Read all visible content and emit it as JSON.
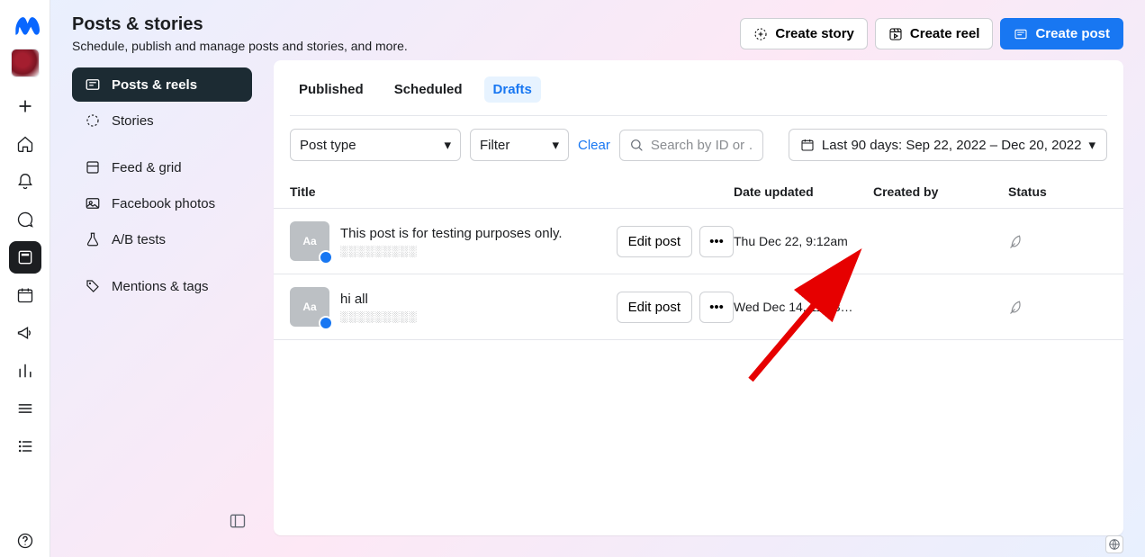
{
  "header": {
    "title": "Posts & stories",
    "subtitle": "Schedule, publish and manage posts and stories, and more.",
    "actions": {
      "create_story": "Create story",
      "create_reel": "Create reel",
      "create_post": "Create post"
    }
  },
  "sidebar": {
    "items": [
      {
        "label": "Posts & reels"
      },
      {
        "label": "Stories"
      },
      {
        "label": "Feed & grid"
      },
      {
        "label": "Facebook photos"
      },
      {
        "label": "A/B tests"
      },
      {
        "label": "Mentions & tags"
      }
    ]
  },
  "tabs": {
    "published": "Published",
    "scheduled": "Scheduled",
    "drafts": "Drafts"
  },
  "filters": {
    "post_type": "Post type",
    "filter": "Filter",
    "clear": "Clear",
    "search_placeholder": "Search by ID or …",
    "date_range": "Last 90 days: Sep 22, 2022 – Dec 20, 2022"
  },
  "table": {
    "columns": {
      "title": "Title",
      "date": "Date updated",
      "created": "Created by",
      "status": "Status"
    },
    "rows": [
      {
        "title": "This post is for testing purposes only.",
        "edit_label": "Edit post",
        "date": "Thu Dec 22, 9:12am"
      },
      {
        "title": "hi all",
        "edit_label": "Edit post",
        "date": "Wed Dec 14, 11:43…"
      }
    ]
  }
}
